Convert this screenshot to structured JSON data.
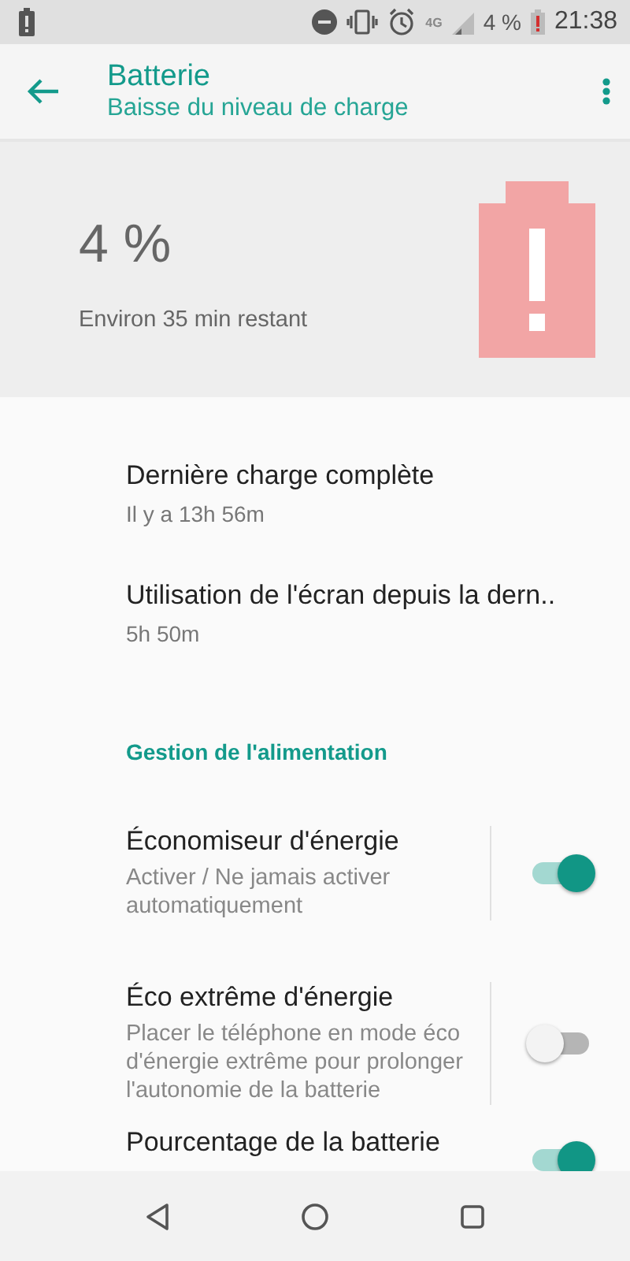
{
  "status_bar": {
    "network": "4G",
    "battery_text": "4 %",
    "time": "21:38"
  },
  "app_bar": {
    "title": "Batterie",
    "subtitle": "Baisse du niveau de charge"
  },
  "summary": {
    "level_text": "4 %",
    "estimate": "Environ 35 min restant"
  },
  "info_items": [
    {
      "title": "Dernière charge complète",
      "subtitle": "Il y a 13h 56m"
    },
    {
      "title": "Utilisation de l'écran depuis la dern..",
      "subtitle": "5h 50m"
    }
  ],
  "section": {
    "title": "Gestion de l'alimentation"
  },
  "settings": [
    {
      "title": "Économiseur d'énergie",
      "summary": "Activer / Ne jamais activer automatiquement",
      "on": true
    },
    {
      "title": "Éco extrême d'énergie",
      "summary": "Placer le téléphone en mode éco d'énergie extrême pour prolonger l'autonomie de la batterie",
      "on": false
    },
    {
      "title": "Pourcentage de la batterie",
      "on": true
    }
  ]
}
